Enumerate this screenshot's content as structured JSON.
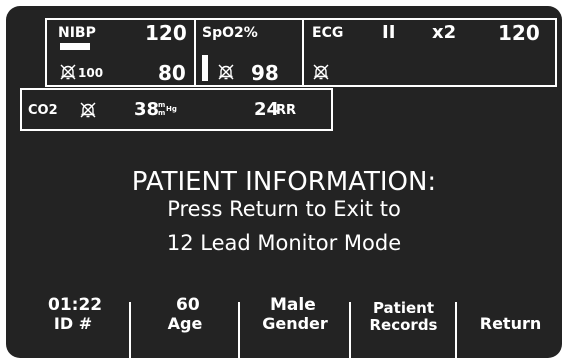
{
  "vitals_panel": {
    "nibp": {
      "label": "NIBP",
      "systolic": "120",
      "diastolic": "80",
      "alarm_limit": "100",
      "alarm_icon": "alarm-off-icon"
    },
    "spo2": {
      "label": "SpO2%",
      "value": "98",
      "alarm_icon": "alarm-off-icon"
    },
    "ecg": {
      "label": "ECG",
      "lead": "II",
      "gain": "x2",
      "heart_rate": "120",
      "alarm_icon": "alarm-off-icon"
    }
  },
  "co2_panel": {
    "label": "CO2",
    "etco2_value": "38",
    "etco2_unit_top": "m",
    "etco2_unit_bottom": "m",
    "etco2_unit_side": "Hg",
    "resp_rate": "24",
    "resp_unit": "RR",
    "alarm_icon": "alarm-off-icon"
  },
  "message": {
    "title": "PATIENT INFORMATION:",
    "line1": "Press Return to Exit to",
    "line2": "12 Lead Monitor Mode"
  },
  "patient_values": {
    "id": "01:22",
    "age": "60",
    "gender": "Male"
  },
  "softkeys": {
    "id": "ID #",
    "age": "Age",
    "gender": "Gender",
    "records_line1": "Patient",
    "records_line2": "Records",
    "return": "Return"
  },
  "colors": {
    "screen_background": "#232323",
    "foreground": "#ffffff"
  }
}
